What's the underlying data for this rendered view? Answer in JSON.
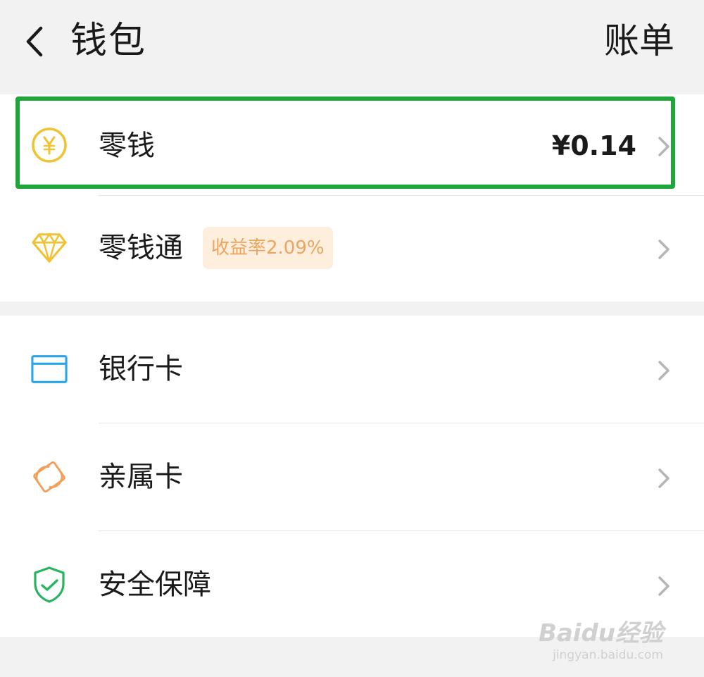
{
  "header": {
    "title": "钱包",
    "bill_label": "账单",
    "back_icon": "chevron-left-icon"
  },
  "wallet_section": {
    "items": [
      {
        "label": "零钱",
        "value": "¥0.14",
        "icon": "yuan-coin-icon",
        "icon_color": "#f1c232",
        "highlighted": true,
        "highlight_color": "#1fa63a"
      },
      {
        "label": "零钱通",
        "badge": "收益率2.09%",
        "icon": "diamond-icon",
        "icon_color": "#f1c232"
      }
    ]
  },
  "services_section": {
    "items": [
      {
        "label": "银行卡",
        "icon": "bank-card-icon",
        "icon_color": "#2aa4e6"
      },
      {
        "label": "亲属卡",
        "icon": "family-card-icon",
        "icon_color": "#f0a05a"
      },
      {
        "label": "安全保障",
        "icon": "shield-check-icon",
        "icon_color": "#26b55e"
      }
    ]
  },
  "watermark": {
    "brand": "Baidu经验",
    "url": "jingyan.baidu.com"
  }
}
